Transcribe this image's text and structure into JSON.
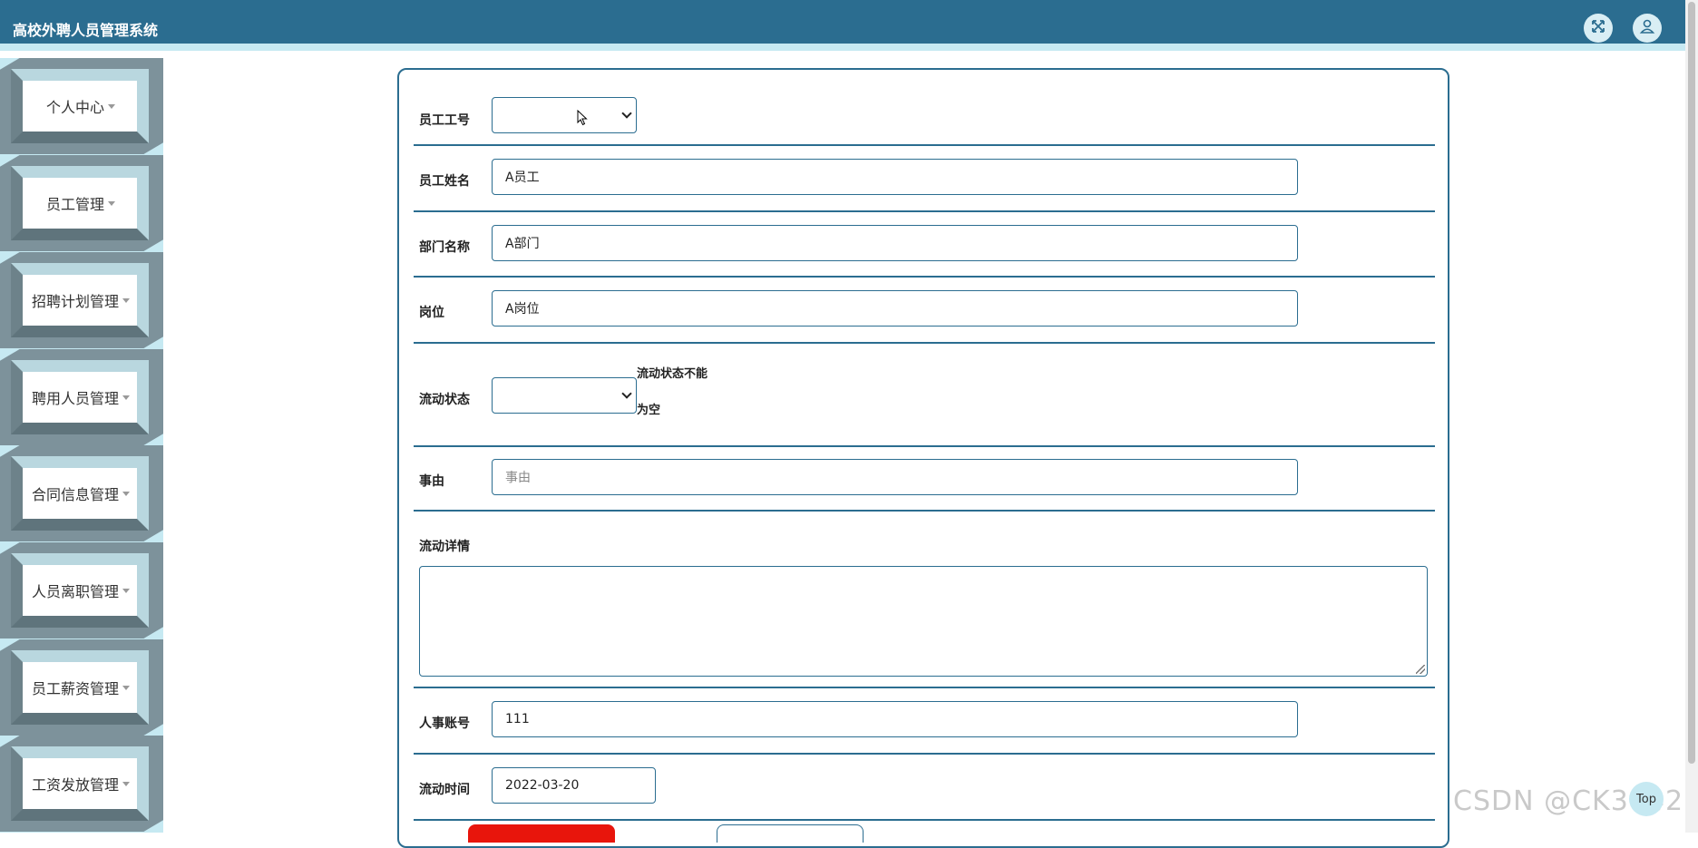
{
  "header": {
    "title": "高校外聘人员管理系统",
    "fullscreen_icon": "fullscreen-icon",
    "user_icon": "user-icon"
  },
  "sidebar": {
    "items": [
      {
        "label": "个人中心"
      },
      {
        "label": "员工管理"
      },
      {
        "label": "招聘计划管理"
      },
      {
        "label": "聘用人员管理"
      },
      {
        "label": "合同信息管理"
      },
      {
        "label": "人员离职管理"
      },
      {
        "label": "员工薪资管理"
      },
      {
        "label": "工资发放管理"
      }
    ]
  },
  "form": {
    "employee_id": {
      "label": "员工工号",
      "value": ""
    },
    "employee_name": {
      "label": "员工姓名",
      "value": "A员工"
    },
    "department": {
      "label": "部门名称",
      "value": "A部门"
    },
    "position": {
      "label": "岗位",
      "value": "A岗位"
    },
    "flow_status": {
      "label": "流动状态",
      "value": "",
      "error": "流动状态不能为空"
    },
    "reason": {
      "label": "事由",
      "placeholder": "事由"
    },
    "flow_detail": {
      "label": "流动详情",
      "value": ""
    },
    "hr_account": {
      "label": "人事账号",
      "value": "111"
    },
    "flow_time": {
      "label": "流动时间",
      "value": "2022-03-20"
    }
  },
  "watermark": "CSDN @CK3042",
  "top_button": "Top",
  "colors": {
    "header": "#2b6d90",
    "sidebar_bg": "#c6e9f2",
    "border": "#2b6d90",
    "submit": "#e8150c"
  }
}
